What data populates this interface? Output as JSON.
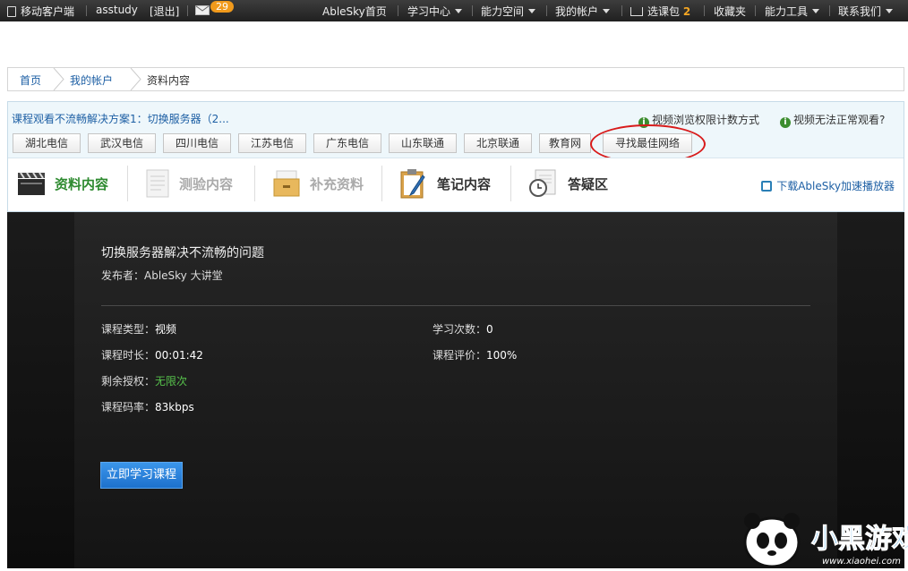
{
  "topbar": {
    "mobile": "移动客户端",
    "username": "asstudy",
    "logout": "[退出]",
    "mail_count": "29",
    "home": "AbleSky首页",
    "study_center": "学习中心",
    "ability_space": "能力空间",
    "my_account": "我的帐户",
    "cart_label": "选课包",
    "cart_count": "2",
    "favorites": "收藏夹",
    "tools": "能力工具",
    "contact": "联系我们"
  },
  "breadcrumb": {
    "items": [
      "首页",
      "我的帐户",
      "资料内容"
    ]
  },
  "panel": {
    "lesson_title": "课程观看不流畅解决方案1：切换服务器（2...",
    "tip_count": "视频浏览权限计数方式",
    "tip_cant_watch": "视频无法正常观看?",
    "servers": [
      "湖北电信",
      "武汉电信",
      "四川电信",
      "江苏电信",
      "广东电信",
      "山东联通",
      "北京联通",
      "教育网",
      "寻找最佳网络"
    ],
    "tabs": [
      "资料内容",
      "测验内容",
      "补充资料",
      "笔记内容",
      "答疑区"
    ],
    "download": "下载AbleSky加速播放器",
    "colors": {
      "accent_green": "#2d8a2f",
      "link_blue": "#1d5fa4",
      "highlight_red": "#d81b1b"
    }
  },
  "content": {
    "title": "切换服务器解决不流畅的问题",
    "publisher": "发布者：AbleSky 大讲堂",
    "type_label": "课程类型：",
    "type_value": "视频",
    "duration_label": "课程时长：",
    "duration_value": "00:01:42",
    "remaining_label": "剩余授权：",
    "remaining_value": "无限次",
    "bitrate_label": "课程码率：",
    "bitrate_value": "83kbps",
    "study_count_label": "学习次数：",
    "study_count_value": "0",
    "rating_label": "课程评价：",
    "rating_value": "100%",
    "study_button": "立即学习课程"
  },
  "watermark": {
    "brand": "小黑游戏",
    "url": "www.xiaohei.com"
  }
}
